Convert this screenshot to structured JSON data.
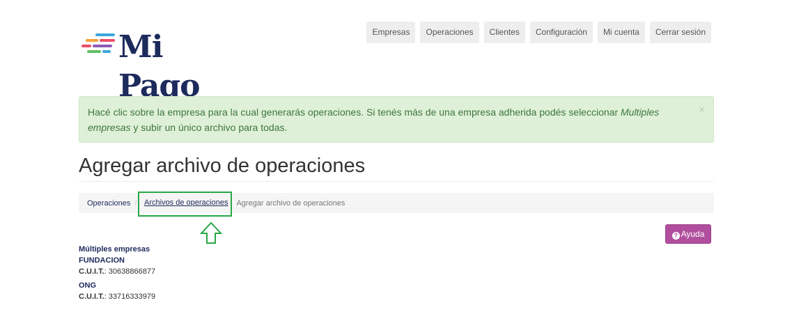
{
  "logo": {
    "text": "Mi Pago",
    "stripe_colors": [
      "#f4a13b",
      "#3aa6db",
      "#e84f6a",
      "#8e5bb5",
      "#5fbf65",
      "#1d2a5c"
    ]
  },
  "nav": {
    "items": [
      "Empresas",
      "Operaciones",
      "Clientes",
      "Configuración",
      "Mi cuenta",
      "Cerrar sesión"
    ]
  },
  "alert": {
    "text_before": "Hacé clic sobre la empresa para la cual generarás operaciones. Si tenés más de una empresa adherida podés seleccionar ",
    "emphasis": "Multiples empresas",
    "text_after": " y subir un único archivo para todas.",
    "close": "×"
  },
  "page": {
    "title": "Agregar archivo de operaciones"
  },
  "breadcrumb": {
    "items": [
      "Operaciones",
      "Archivos de operaciones",
      "Agregar archivo de operaciones"
    ],
    "separator": "/"
  },
  "help_button": {
    "label": "Ayuda",
    "icon": "question-circle-icon"
  },
  "companies": {
    "multi_label": "Múltiples empresas",
    "list": [
      {
        "name": "FUNDACION",
        "cuit_label": "C.U.I.T.",
        "cuit": ": 30638866877"
      },
      {
        "name": "ONG",
        "cuit_label": "C.U.I.T.",
        "cuit": ": 33716333979"
      }
    ]
  },
  "colors": {
    "brand": "#1d2a5c",
    "accent": "#b14f9e",
    "alert_bg": "#dff0d8",
    "highlight": "#28a745"
  }
}
